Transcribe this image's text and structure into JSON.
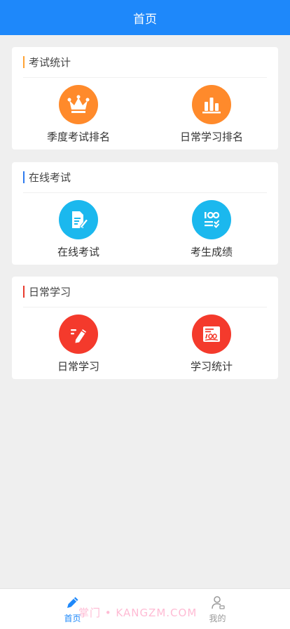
{
  "header": {
    "title": "首页"
  },
  "colors": {
    "primary": "#1E88FA",
    "orange": "#FF8A2B",
    "cyan": "#1BB8EE",
    "red": "#F43A2C",
    "tab_inactive": "#999999"
  },
  "sections": [
    {
      "title": "考试统计",
      "accent": "#FFA233",
      "items": [
        {
          "label": "季度考试排名",
          "icon": "crown-icon"
        },
        {
          "label": "日常学习排名",
          "icon": "bar-chart-icon"
        }
      ]
    },
    {
      "title": "在线考试",
      "accent": "#2E7BEF",
      "items": [
        {
          "label": "在线考试",
          "icon": "document-edit-icon"
        },
        {
          "label": "考生成绩",
          "icon": "score-list-icon"
        }
      ]
    },
    {
      "title": "日常学习",
      "accent": "#E83B2E",
      "items": [
        {
          "label": "日常学习",
          "icon": "pencil-icon"
        },
        {
          "label": "学习统计",
          "icon": "score-100-icon"
        }
      ]
    }
  ],
  "tabbar": {
    "items": [
      {
        "label": "首页",
        "icon": "pencil-icon",
        "active": true
      },
      {
        "label": "我的",
        "icon": "user-icon",
        "active": false
      }
    ]
  },
  "watermark": "掌门 • KANGZM.COM"
}
